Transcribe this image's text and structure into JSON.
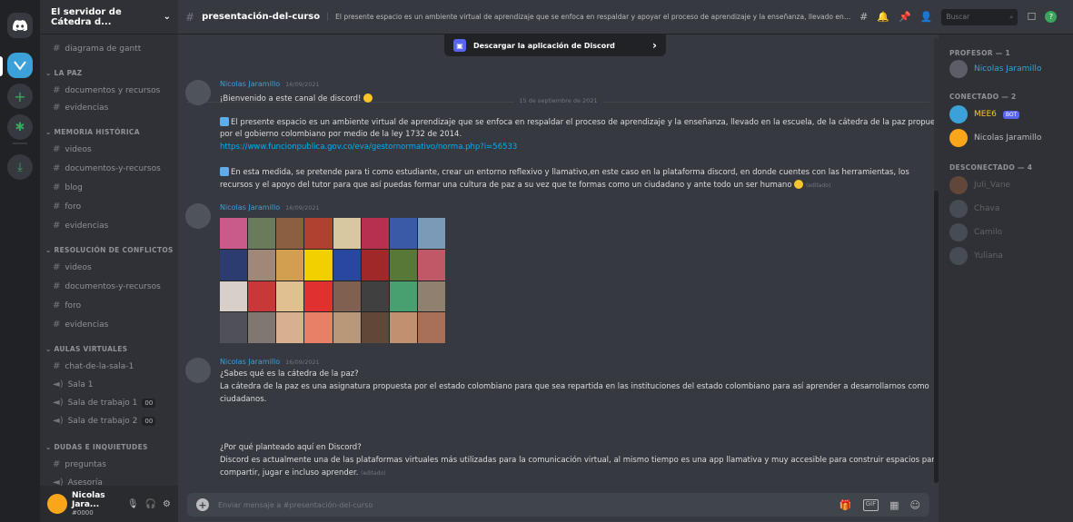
{
  "rail": {
    "home_icon": "discord-logo-icon",
    "add_icon": "+",
    "explore_icon": "✱",
    "download_icon": "⤓"
  },
  "guild": {
    "name": "El servidor de Cátedra d...",
    "chevron": "⌄"
  },
  "channels": {
    "top_channel": "diagrama de gantt",
    "categories": [
      {
        "name": "LA PAZ",
        "items": [
          "documentos y recursos",
          "evidencias"
        ]
      },
      {
        "name": "MEMORIA HISTÓRICA",
        "items": [
          "videos",
          "documentos-y-recursos",
          "blog",
          "foro",
          "evidencias"
        ]
      },
      {
        "name": "RESOLUCIÓN DE CONFLICTOS",
        "items": [
          "videos",
          "documentos-y-recursos",
          "foro",
          "evidencias"
        ]
      },
      {
        "name": "AULAS VIRTUALES",
        "items": [
          "chat-de-la-sala-1",
          "Sala 1",
          "Sala de trabajo 1",
          "Sala de trabajo 2"
        ]
      },
      {
        "name": "DUDAS E INQUIETUDES",
        "items": [
          "preguntas",
          "Asesoría"
        ]
      }
    ],
    "voice_counts": [
      "00",
      "00"
    ]
  },
  "user_panel": {
    "name": "Nicolas Jara...",
    "tag": "#0000",
    "mic_icon": "🎙",
    "headset_icon": "🎧",
    "settings_icon": "⚙"
  },
  "topbar": {
    "channel_name": "presentación-del-curso",
    "topic": "El presente espacio es un ambiente virtual de aprendizaje que se enfoca en respaldar y apoyar el proceso de aprendizaje y la enseñanza, llevado en la escuela, d...",
    "search_placeholder": "Buscar",
    "threads_icon": "#",
    "bell_icon": "🔔",
    "pin_icon": "📌",
    "members_icon": "👤",
    "inbox_icon": "☐",
    "help_icon": "?"
  },
  "banner": {
    "label": "Descargar la aplicación de Discord",
    "arrow": "›"
  },
  "date_divider": "15 de septiembre de 2021",
  "messages": [
    {
      "author": "Nicolas Jaramillo",
      "time": "16/09/2021",
      "lines": [
        "¡Bienvenido a este canal de discord!",
        "El presente espacio es un ambiente virtual de aprendizaje que se enfoca en respaldar el proceso de aprendizaje y la enseñanza, llevado en la escuela, de la cátedra de la paz propuesta",
        "por el gobierno colombiano por medio de la ley 1732 de 2014.",
        "https://www.funcionpublica.gov.co/eva/gestornormativo/norma.php?i=56533",
        "En esta medida, se pretende para ti como estudiante, crear un entorno reflexivo y llamativo,en este caso en la plataforma discord, en donde cuentes con las herramientas, los",
        "recursos y el apoyo del tutor para que así puedas formar una cultura de paz a su vez que te formas como un ciudadano y ante todo un  ser humano"
      ],
      "edited": "(editado)"
    },
    {
      "author": "Nicolas Jaramillo",
      "time": "16/09/2021"
    },
    {
      "author": "Nicolas Jaramillo",
      "time": "16/09/2021",
      "lines": [
        "¿Sabes qué es la cátedra de la paz?",
        "La cátedra de la paz es una asignatura propuesta por el estado colombiano para que sea repartida en las instituciones del estado colombiano para así aprender a desarrollarnos como",
        "ciudadanos.",
        "¿Por qué planteado aquí en Discord?",
        "Discord es actualmente una de las plataformas virtuales más utilizadas para la comunicación virtual, al mismo tiempo es una app llamativa y muy accesible para construir espacios para",
        "compartir, jugar e incluso aprender."
      ],
      "edited": "(editado)"
    }
  ],
  "input": {
    "placeholder": "Enviar mensaje a #presentación-del-curso",
    "plus": "+",
    "gift_icon": "🎁",
    "gif_icon": "GIF",
    "sticker_icon": "▦",
    "emoji_icon": "☺"
  },
  "members": {
    "sections": [
      {
        "title": "PROFESOR — 1",
        "people": [
          {
            "name": "Nicolas Jaramillo",
            "color": "#3ba1d8"
          }
        ]
      },
      {
        "title": "CONECTADO — 2",
        "people": [
          {
            "name": "MEE6",
            "color": "#f8c52b",
            "bot": "BOT"
          },
          {
            "name": "Nicolas Jaramillo",
            "color": "#dcddde"
          }
        ]
      },
      {
        "title": "DESCONECTADO — 4",
        "people": [
          {
            "name": "Juli_Vane"
          },
          {
            "name": "Chava"
          },
          {
            "name": "Camilo"
          },
          {
            "name": "Yuliana"
          }
        ]
      }
    ]
  }
}
